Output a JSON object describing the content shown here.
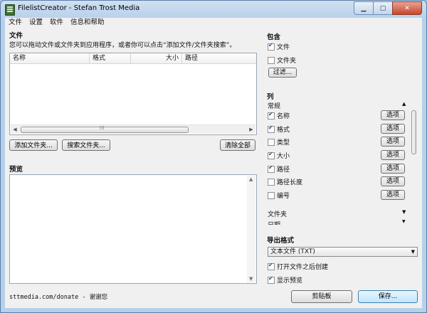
{
  "window": {
    "title": "FilelistCreator - Stefan Trost Media"
  },
  "menu": [
    "文件",
    "设置",
    "软件",
    "信息和帮助"
  ],
  "files": {
    "heading": "文件",
    "hint": "您可以拖动文件或文件夹到应用程序，或者你可以点击“添加文件/文件夹搜索”。",
    "columns": [
      "名称",
      "格式",
      "大小",
      "路径"
    ],
    "scroll_grip": "⁞⁞⁞"
  },
  "buttons": {
    "add_files": "添加文件夹...",
    "search_folder": "搜索文件夹...",
    "clear_all": "清除全部",
    "filter": "过滤...",
    "clipboard": "剪贴板",
    "save": "保存..."
  },
  "preview": {
    "heading": "预览"
  },
  "include": {
    "heading": "包含",
    "files": {
      "label": "文件",
      "checked": true
    },
    "folders": {
      "label": "文件夹",
      "checked": false
    }
  },
  "columns_section": {
    "heading": "列",
    "group": "常规",
    "option_label": "选项",
    "items": [
      {
        "label": "名称",
        "checked": true
      },
      {
        "label": "格式",
        "checked": true
      },
      {
        "label": "类型",
        "checked": false
      },
      {
        "label": "大小",
        "checked": true
      },
      {
        "label": "路径",
        "checked": true
      },
      {
        "label": "路径长度",
        "checked": false
      },
      {
        "label": "编号",
        "checked": false
      }
    ],
    "folder_group": "文件夹",
    "date_group_partial": "日期"
  },
  "export": {
    "heading": "导出格式",
    "format": "文本文件 (TXT)",
    "create_after_open": {
      "label": "打开文件之后创建",
      "checked": true
    },
    "show_preview": {
      "label": "显示预览",
      "checked": true
    }
  },
  "footer": {
    "donate": "sttmedia.com/donate - 谢谢您"
  }
}
